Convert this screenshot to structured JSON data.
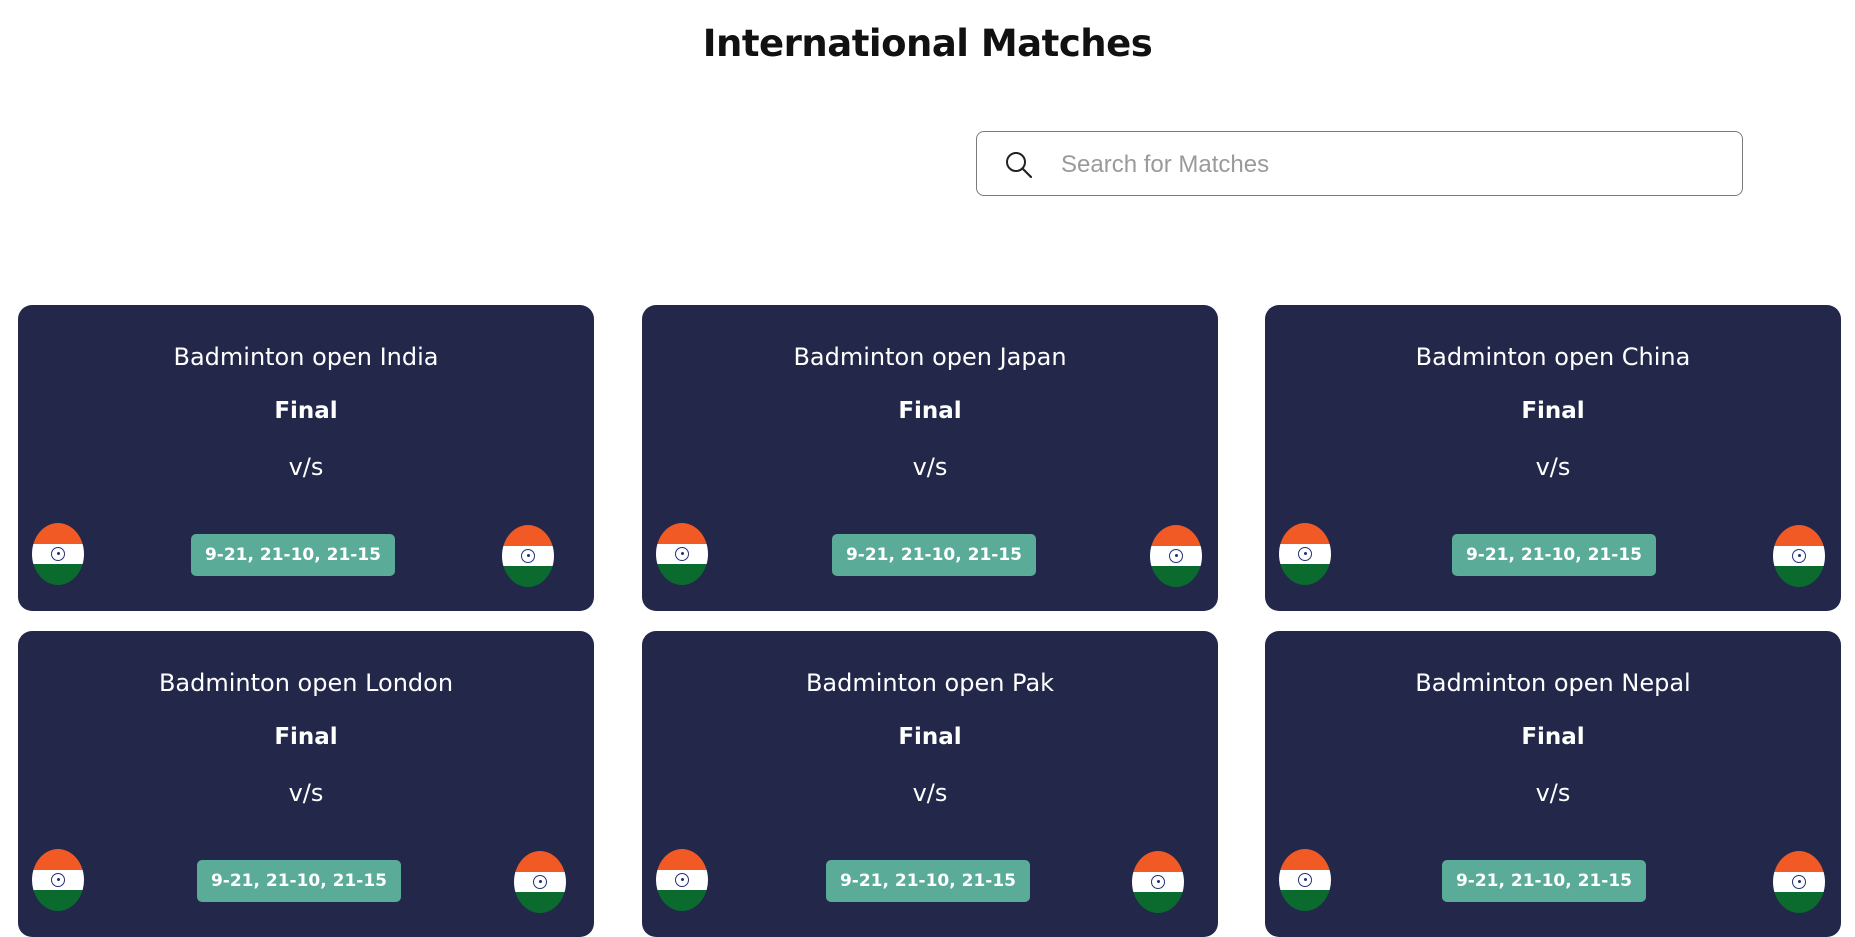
{
  "page": {
    "title": "International Matches"
  },
  "search": {
    "placeholder": "Search for Matches",
    "value": ""
  },
  "icons": {
    "search": "search-icon",
    "flag": "india-flag-icon"
  },
  "colors": {
    "card": "#23284b",
    "score_badge": "#5aab98",
    "text": "#ffffff"
  },
  "matches": [
    {
      "title": "Badminton open India",
      "round": "Final",
      "vs": "v/s",
      "score": "9-21, 21-10, 21-15"
    },
    {
      "title": "Badminton open Japan",
      "round": "Final",
      "vs": "v/s",
      "score": "9-21, 21-10, 21-15"
    },
    {
      "title": "Badminton open China",
      "round": "Final",
      "vs": "v/s",
      "score": "9-21, 21-10, 21-15"
    },
    {
      "title": "Badminton open London",
      "round": "Final",
      "vs": "v/s",
      "score": "9-21, 21-10, 21-15"
    },
    {
      "title": "Badminton open Pak",
      "round": "Final",
      "vs": "v/s",
      "score": "9-21, 21-10, 21-15"
    },
    {
      "title": "Badminton open Nepal",
      "round": "Final",
      "vs": "v/s",
      "score": "9-21, 21-10, 21-15"
    }
  ]
}
